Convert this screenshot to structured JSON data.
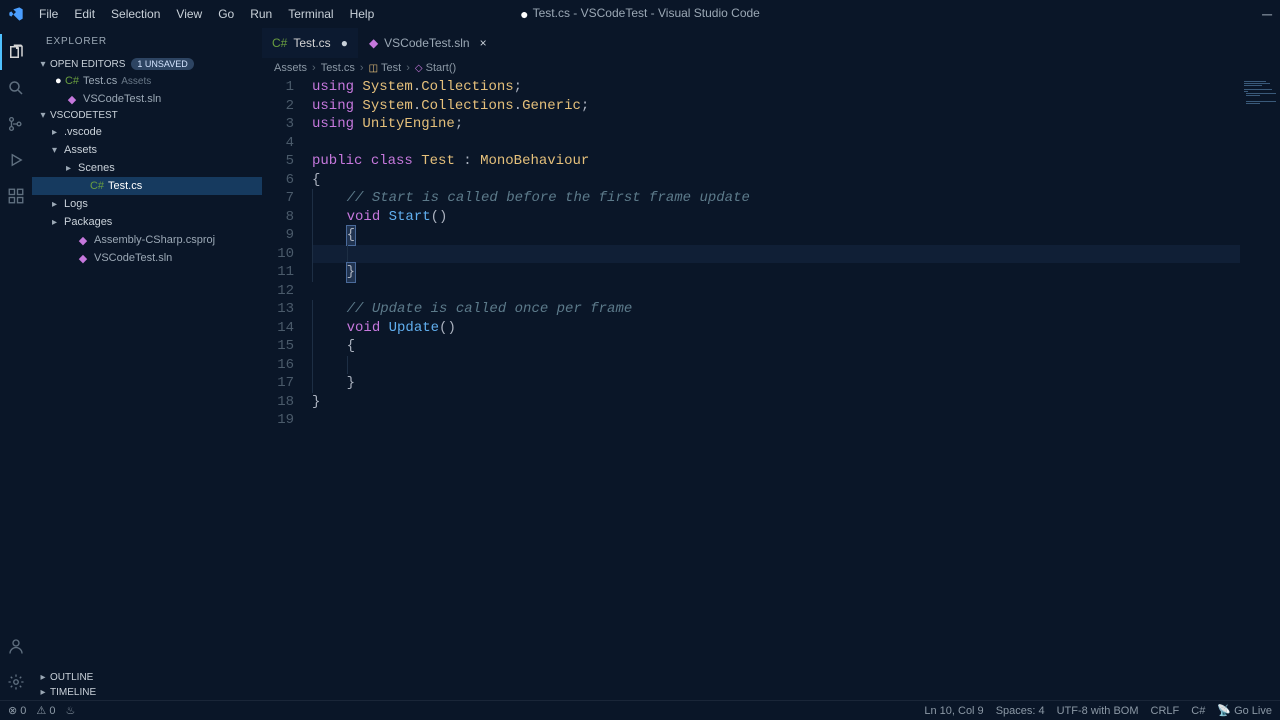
{
  "window": {
    "title": "Test.cs - VSCodeTest - Visual Studio Code"
  },
  "menu": [
    "File",
    "Edit",
    "Selection",
    "View",
    "Go",
    "Run",
    "Terminal",
    "Help"
  ],
  "activity": [
    "files",
    "search",
    "scm",
    "debug",
    "extensions"
  ],
  "sidebar": {
    "title": "EXPLORER",
    "open_editors": {
      "label": "OPEN EDITORS",
      "badge": "1 UNSAVED",
      "items": [
        {
          "name": "Test.cs",
          "dim": "Assets",
          "modified": true,
          "icon": "cs"
        },
        {
          "name": "VSCodeTest.sln",
          "modified": false,
          "icon": "sln"
        }
      ]
    },
    "workspace": {
      "label": "VSCODETEST",
      "tree": [
        {
          "name": ".vscode",
          "type": "folder",
          "depth": 0,
          "expanded": false
        },
        {
          "name": "Assets",
          "type": "folder",
          "depth": 0,
          "expanded": true
        },
        {
          "name": "Scenes",
          "type": "folder",
          "depth": 1,
          "expanded": false
        },
        {
          "name": "Test.cs",
          "type": "file",
          "depth": 1,
          "icon": "cs",
          "selected": true
        },
        {
          "name": "Logs",
          "type": "folder",
          "depth": 0,
          "expanded": false
        },
        {
          "name": "Packages",
          "type": "folder",
          "depth": 0,
          "expanded": false
        },
        {
          "name": "Assembly-CSharp.csproj",
          "type": "file",
          "depth": 0,
          "icon": "proj"
        },
        {
          "name": "VSCodeTest.sln",
          "type": "file",
          "depth": 0,
          "icon": "sln"
        }
      ]
    },
    "outline": "OUTLINE",
    "timeline": "TIMELINE"
  },
  "tabs": [
    {
      "name": "Test.cs",
      "icon": "cs",
      "active": true,
      "modified": true
    },
    {
      "name": "VSCodeTest.sln",
      "icon": "sln",
      "active": false,
      "modified": false
    }
  ],
  "breadcrumbs": [
    "Assets",
    "Test.cs",
    "Test",
    "Start()"
  ],
  "code": {
    "lines": [
      [
        [
          "key",
          "using "
        ],
        [
          "type",
          "System"
        ],
        [
          "punc",
          "."
        ],
        [
          "type",
          "Collections"
        ],
        [
          "punc",
          ";"
        ]
      ],
      [
        [
          "key",
          "using "
        ],
        [
          "type",
          "System"
        ],
        [
          "punc",
          "."
        ],
        [
          "type",
          "Collections"
        ],
        [
          "punc",
          "."
        ],
        [
          "type",
          "Generic"
        ],
        [
          "punc",
          ";"
        ]
      ],
      [
        [
          "key",
          "using "
        ],
        [
          "type",
          "UnityEngine"
        ],
        [
          "punc",
          ";"
        ]
      ],
      [],
      [
        [
          "key",
          "public "
        ],
        [
          "key",
          "class "
        ],
        [
          "class",
          "Test"
        ],
        [
          "punc",
          " : "
        ],
        [
          "class",
          "MonoBehaviour"
        ]
      ],
      [
        [
          "punc",
          "{"
        ]
      ],
      [
        [
          "pad",
          "    "
        ],
        [
          "comment",
          "// Start is called before the first frame update"
        ]
      ],
      [
        [
          "pad",
          "    "
        ],
        [
          "key",
          "void "
        ],
        [
          "method",
          "Start"
        ],
        [
          "punc",
          "()"
        ]
      ],
      [
        [
          "pad",
          "    "
        ],
        [
          "bracket",
          "{"
        ]
      ],
      [
        [
          "pad",
          "        "
        ]
      ],
      [
        [
          "pad",
          "    "
        ],
        [
          "bracket",
          "}"
        ]
      ],
      [],
      [
        [
          "pad",
          "    "
        ],
        [
          "comment",
          "// Update is called once per frame"
        ]
      ],
      [
        [
          "pad",
          "    "
        ],
        [
          "key",
          "void "
        ],
        [
          "method",
          "Update"
        ],
        [
          "punc",
          "()"
        ]
      ],
      [
        [
          "pad",
          "    "
        ],
        [
          "punc",
          "{"
        ]
      ],
      [
        [
          "pad",
          "        "
        ]
      ],
      [
        [
          "pad",
          "    "
        ],
        [
          "punc",
          "}"
        ]
      ],
      [
        [
          "punc",
          "}"
        ]
      ],
      []
    ]
  },
  "status": {
    "errors": "0",
    "warnings": "0",
    "position": "Ln 10, Col 9",
    "spaces": "Spaces: 4",
    "encoding": "UTF-8 with BOM",
    "eol": "CRLF",
    "lang": "C#",
    "golive": "Go Live"
  }
}
